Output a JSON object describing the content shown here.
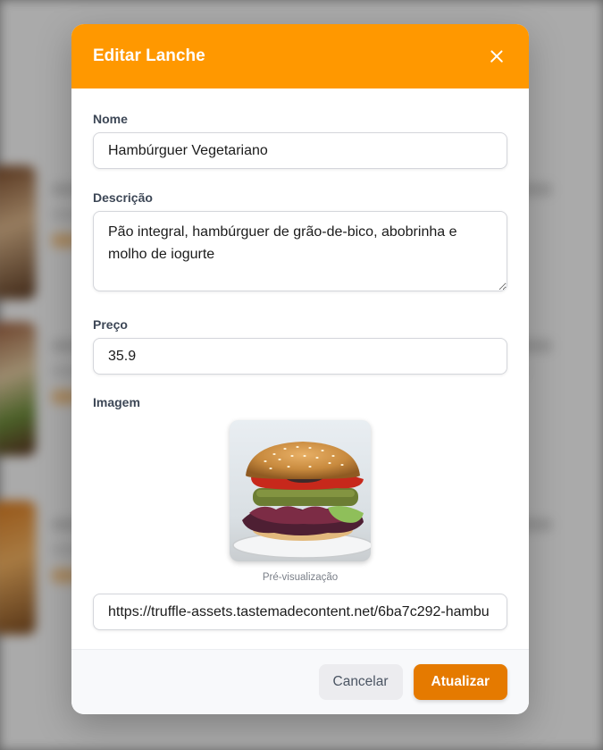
{
  "modal": {
    "title": "Editar Lanche",
    "close_icon": "close-icon"
  },
  "form": {
    "name": {
      "label": "Nome",
      "value": "Hambúrguer Vegetariano"
    },
    "description": {
      "label": "Descrição",
      "value": "Pão integral, hambúrguer de grão-de-bico, abobrinha e molho de iogurte"
    },
    "price": {
      "label": "Preço",
      "value": "35.9"
    },
    "image": {
      "label": "Imagem",
      "preview_caption": "Pré-visualização",
      "url_value": "https://truffle-assets.tastemadecontent.net/6ba7c292-hambu"
    }
  },
  "footer": {
    "cancel_label": "Cancelar",
    "update_label": "Atualizar"
  },
  "colors": {
    "header": "#ff9800",
    "primary_button": "#e57a00"
  }
}
